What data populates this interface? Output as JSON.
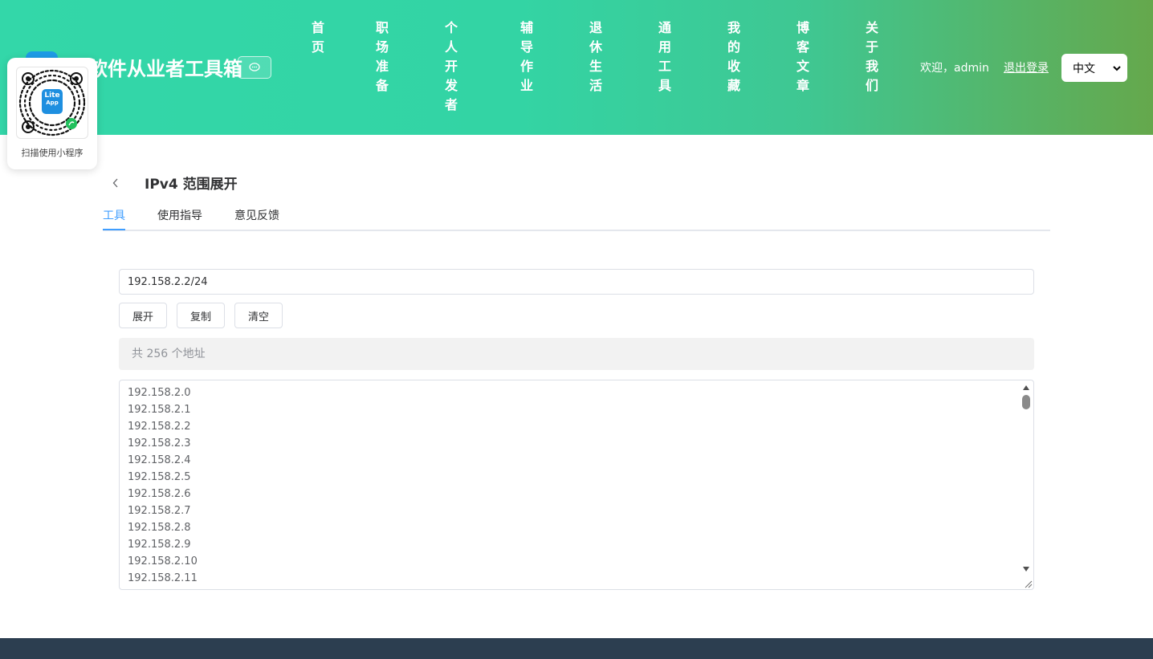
{
  "header": {
    "site_title": "软件从业者工具箱",
    "nav": [
      "首页",
      "职场准备",
      "个人开发者",
      "辅导作业",
      "退休生活",
      "通用工具",
      "我的收藏",
      "博客文章",
      "关于我们"
    ],
    "welcome": "欢迎，admin",
    "logout": "退出登录",
    "language": "中文",
    "chat_icon": "chat-bubble-icon"
  },
  "qr": {
    "caption": "扫描使用小程序",
    "badge_top": "Lite",
    "badge_bottom": "App"
  },
  "page": {
    "title": "IPv4 范围展开",
    "tabs": [
      "工具",
      "使用指导",
      "意见反馈"
    ],
    "active_tab": "工具"
  },
  "tool": {
    "input_value": "192.158.2.2/24",
    "buttons": {
      "expand": "展开",
      "copy": "复制",
      "clear": "清空"
    },
    "count_text": "共 256 个地址",
    "results": [
      "192.158.2.0",
      "192.158.2.1",
      "192.158.2.2",
      "192.158.2.3",
      "192.158.2.4",
      "192.158.2.5",
      "192.158.2.6",
      "192.158.2.7",
      "192.158.2.8",
      "192.158.2.9",
      "192.158.2.10",
      "192.158.2.11"
    ]
  },
  "colors": {
    "header_start": "#33d7a9",
    "header_end": "#65a84c",
    "active_tab": "#409eff",
    "footer": "#2c3e50"
  }
}
